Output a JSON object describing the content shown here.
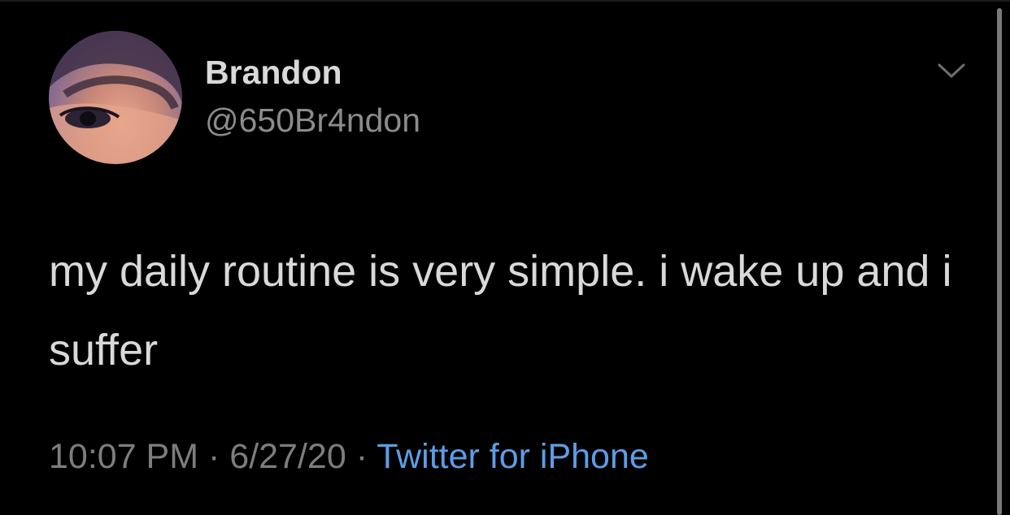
{
  "tweet": {
    "display_name": "Brandon",
    "handle": "@650Br4ndon",
    "text": "my daily routine is very simple. i wake up and i suffer",
    "time": "10:07 PM",
    "separator": " · ",
    "date": "6/27/20",
    "source": "Twitter for iPhone"
  },
  "icons": {
    "menu": "chevron-down-icon",
    "avatar": "profile-photo"
  },
  "colors": {
    "background": "#000000",
    "text_primary": "#d9d9d9",
    "text_secondary": "#8b8b8b",
    "link": "#5b9ee6"
  }
}
